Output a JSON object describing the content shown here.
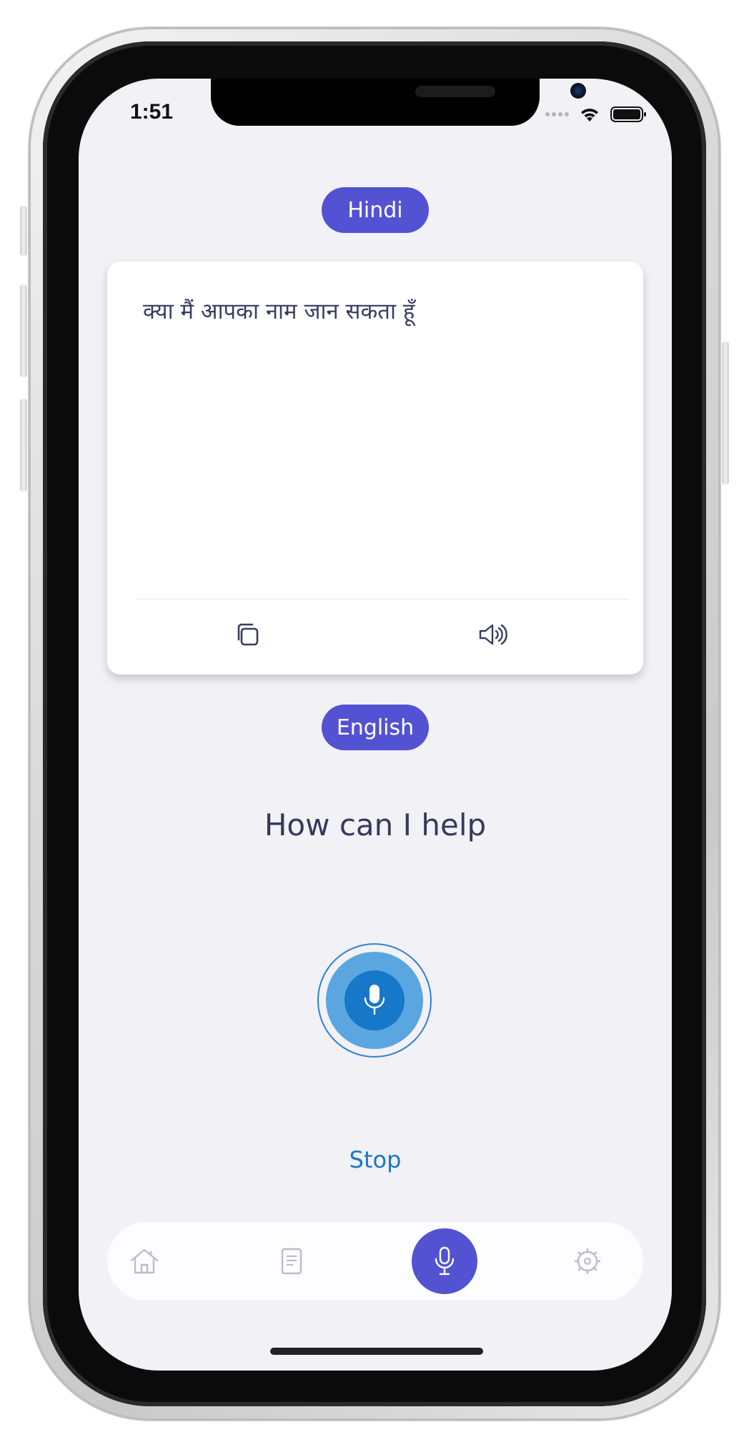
{
  "status_bar": {
    "time": "1:51",
    "icons": [
      "signal-icon",
      "wifi-icon",
      "battery-icon"
    ]
  },
  "source_language": {
    "label": "Hindi"
  },
  "translation_card": {
    "text": "क्या मैं आपका नाम जान सकता हूँ",
    "actions": [
      "copy-icon",
      "speaker-icon"
    ]
  },
  "target_language": {
    "label": "English"
  },
  "prompt": {
    "text": "How can I help"
  },
  "mic": {
    "icon": "microphone-icon",
    "state": "listening"
  },
  "stop": {
    "label": "Stop"
  },
  "tab_bar": {
    "tabs": [
      {
        "icon": "home-icon",
        "active": false
      },
      {
        "icon": "document-icon",
        "active": false
      },
      {
        "icon": "microphone-icon",
        "active": true
      },
      {
        "icon": "settings-icon",
        "active": false
      }
    ]
  },
  "colors": {
    "accent": "#5352d3",
    "mic_blue": "#1777c8",
    "mic_light": "#5aa6e0",
    "background": "#f2f1f6",
    "text_dark": "#353a5c"
  }
}
